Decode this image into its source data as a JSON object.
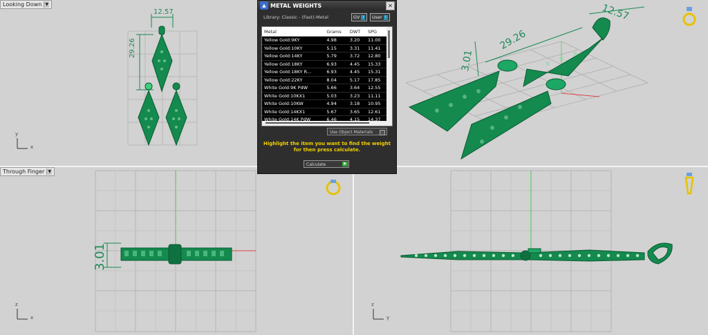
{
  "viewports": {
    "top_left": {
      "label": "Looking Down",
      "axes": [
        "y",
        "x"
      ]
    },
    "bottom_left": {
      "label": "Through Finger",
      "axes": [
        "z",
        "x"
      ]
    },
    "bottom_right": {
      "axes": [
        "z",
        "y"
      ]
    },
    "top_right": {}
  },
  "dimensions": {
    "width": "12.57",
    "height": "29.26",
    "depth": "3.01"
  },
  "panel": {
    "title": "METAL WEIGHTS",
    "library_label": "Library: Classic - (Fast)-Metal",
    "toggle_gv": "GV",
    "toggle_user": "User",
    "columns": [
      "Metal",
      "Grams",
      "DWT",
      "SPG"
    ],
    "rows": [
      [
        "Yellow Gold:9KY",
        "4.98",
        "3.20",
        "11.00"
      ],
      [
        "Yellow Gold:10KY",
        "5.15",
        "3.31",
        "11.41"
      ],
      [
        "Yellow Gold:14KY",
        "5.79",
        "3.72",
        "12.80"
      ],
      [
        "Yellow Gold:18KY",
        "6.93",
        "4.45",
        "15.33"
      ],
      [
        "Yellow Gold:18KY R...",
        "6.93",
        "4.45",
        "15.31"
      ],
      [
        "Yellow Gold:22KY",
        "8.04",
        "5.17",
        "17.85"
      ],
      [
        "White Gold:9K PdW",
        "5.66",
        "3.64",
        "12.55"
      ],
      [
        "White Gold:10KX1",
        "5.03",
        "3.23",
        "11.11"
      ],
      [
        "White Gold:10KW",
        "4.94",
        "3.18",
        "10.95"
      ],
      [
        "White Gold:14KX1",
        "5.67",
        "3.65",
        "12.61"
      ],
      [
        "White Gold:14K PdW",
        "6.46",
        "4.15",
        "14.37"
      ]
    ],
    "use_object_materials": "Use Object Materials",
    "hint": "Highlight the item you want to find the weight for then press calculate.",
    "calculate_label": "Calculate"
  },
  "colors": {
    "model": "#148a4e",
    "grid": "#b4b4b4",
    "viewport_bg": "#d2d2d2",
    "hint": "#f2d000"
  }
}
